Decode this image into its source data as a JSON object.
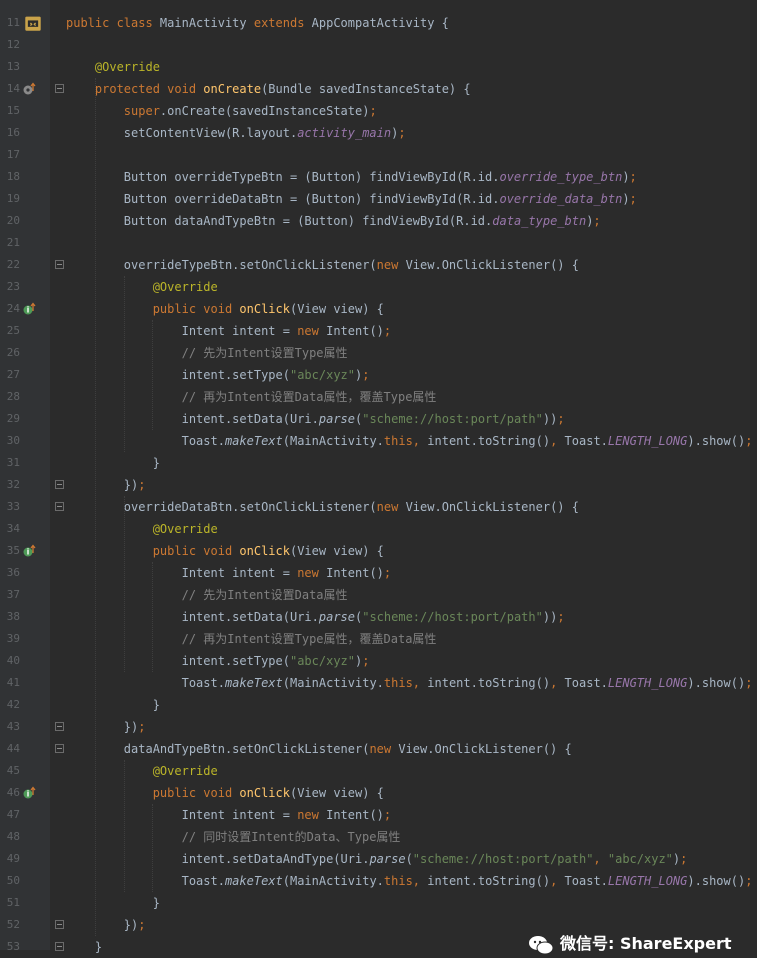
{
  "editor": {
    "lines": [
      {
        "num": "11",
        "segs": [
          [
            "kw",
            "public class "
          ],
          [
            "",
            "MainActivity "
          ],
          [
            "kw",
            "extends "
          ],
          [
            "",
            "AppCompatActivity {"
          ]
        ]
      },
      {
        "num": "12",
        "segs": []
      },
      {
        "num": "13",
        "segs": [
          [
            "",
            "    "
          ],
          [
            "an",
            "@Override"
          ]
        ]
      },
      {
        "num": "14",
        "segs": [
          [
            "",
            "    "
          ],
          [
            "kw",
            "protected void "
          ],
          [
            "fn",
            "onCreate"
          ],
          [
            "",
            "(Bundle savedInstanceState) {"
          ]
        ]
      },
      {
        "num": "15",
        "segs": [
          [
            "",
            "        "
          ],
          [
            "kw",
            "super"
          ],
          [
            "",
            ".onCreate(savedInstanceState)"
          ],
          [
            "kw",
            ";"
          ]
        ]
      },
      {
        "num": "16",
        "segs": [
          [
            "",
            "        setContentView(R.layout."
          ],
          [
            "fi",
            "activity_main"
          ],
          [
            "",
            ")"
          ],
          [
            "kw",
            ";"
          ]
        ]
      },
      {
        "num": "17",
        "segs": []
      },
      {
        "num": "18",
        "segs": [
          [
            "",
            "        Button overrideTypeBtn = (Button) findViewById(R.id."
          ],
          [
            "fi",
            "override_type_btn"
          ],
          [
            "",
            ")"
          ],
          [
            "kw",
            ";"
          ]
        ]
      },
      {
        "num": "19",
        "segs": [
          [
            "",
            "        Button overrideDataBtn = (Button) findViewById(R.id."
          ],
          [
            "fi",
            "override_data_btn"
          ],
          [
            "",
            ")"
          ],
          [
            "kw",
            ";"
          ]
        ]
      },
      {
        "num": "20",
        "segs": [
          [
            "",
            "        Button dataAndTypeBtn = (Button) findViewById(R.id."
          ],
          [
            "fi",
            "data_type_btn"
          ],
          [
            "",
            ")"
          ],
          [
            "kw",
            ";"
          ]
        ]
      },
      {
        "num": "21",
        "segs": []
      },
      {
        "num": "22",
        "segs": [
          [
            "",
            "        overrideTypeBtn.setOnClickListener("
          ],
          [
            "kw",
            "new "
          ],
          [
            "",
            "View.OnClickListener() {"
          ]
        ]
      },
      {
        "num": "23",
        "segs": [
          [
            "",
            "            "
          ],
          [
            "an",
            "@Override"
          ]
        ]
      },
      {
        "num": "24",
        "segs": [
          [
            "",
            "            "
          ],
          [
            "kw",
            "public void "
          ],
          [
            "fn",
            "onClick"
          ],
          [
            "",
            "(View view) {"
          ]
        ]
      },
      {
        "num": "25",
        "segs": [
          [
            "",
            "                Intent intent = "
          ],
          [
            "kw",
            "new "
          ],
          [
            "",
            "Intent()"
          ],
          [
            "kw",
            ";"
          ]
        ]
      },
      {
        "num": "26",
        "segs": [
          [
            "",
            "                "
          ],
          [
            "cm",
            "// 先为Intent设置Type属性"
          ]
        ]
      },
      {
        "num": "27",
        "segs": [
          [
            "",
            "                intent.setType("
          ],
          [
            "st",
            "\"abc/xyz\""
          ],
          [
            "",
            ")"
          ],
          [
            "kw",
            ";"
          ]
        ]
      },
      {
        "num": "28",
        "segs": [
          [
            "",
            "                "
          ],
          [
            "cm",
            "// 再为Intent设置Data属性，覆盖Type属性"
          ]
        ]
      },
      {
        "num": "29",
        "segs": [
          [
            "",
            "                intent.setData(Uri."
          ],
          [
            "sm",
            "parse"
          ],
          [
            "",
            "("
          ],
          [
            "st",
            "\"scheme://host:port/path\""
          ],
          [
            "",
            "))"
          ],
          [
            "kw",
            ";"
          ]
        ]
      },
      {
        "num": "30",
        "segs": [
          [
            "",
            "                Toast."
          ],
          [
            "sm",
            "makeText"
          ],
          [
            "",
            "(MainActivity."
          ],
          [
            "kw",
            "this, "
          ],
          [
            "",
            "intent.toString()"
          ],
          [
            "kw",
            ", "
          ],
          [
            "",
            "Toast."
          ],
          [
            "fi",
            "LENGTH_LONG"
          ],
          [
            "",
            ").show()"
          ],
          [
            "kw",
            ";"
          ]
        ]
      },
      {
        "num": "31",
        "segs": [
          [
            "",
            "            }"
          ]
        ]
      },
      {
        "num": "32",
        "segs": [
          [
            "",
            "        })"
          ],
          [
            "kw",
            ";"
          ]
        ]
      },
      {
        "num": "33",
        "segs": [
          [
            "",
            "        overrideDataBtn.setOnClickListener("
          ],
          [
            "kw",
            "new "
          ],
          [
            "",
            "View.OnClickListener() {"
          ]
        ]
      },
      {
        "num": "34",
        "segs": [
          [
            "",
            "            "
          ],
          [
            "an",
            "@Override"
          ]
        ]
      },
      {
        "num": "35",
        "segs": [
          [
            "",
            "            "
          ],
          [
            "kw",
            "public void "
          ],
          [
            "fn",
            "onClick"
          ],
          [
            "",
            "(View view) {"
          ]
        ]
      },
      {
        "num": "36",
        "segs": [
          [
            "",
            "                Intent intent = "
          ],
          [
            "kw",
            "new "
          ],
          [
            "",
            "Intent()"
          ],
          [
            "kw",
            ";"
          ]
        ]
      },
      {
        "num": "37",
        "segs": [
          [
            "",
            "                "
          ],
          [
            "cm",
            "// 先为Intent设置Data属性"
          ]
        ]
      },
      {
        "num": "38",
        "segs": [
          [
            "",
            "                intent.setData(Uri."
          ],
          [
            "sm",
            "parse"
          ],
          [
            "",
            "("
          ],
          [
            "st",
            "\"scheme://host:port/path\""
          ],
          [
            "",
            "))"
          ],
          [
            "kw",
            ";"
          ]
        ]
      },
      {
        "num": "39",
        "segs": [
          [
            "",
            "                "
          ],
          [
            "cm",
            "// 再为Intent设置Type属性，覆盖Data属性"
          ]
        ]
      },
      {
        "num": "40",
        "segs": [
          [
            "",
            "                intent.setType("
          ],
          [
            "st",
            "\"abc/xyz\""
          ],
          [
            "",
            ")"
          ],
          [
            "kw",
            ";"
          ]
        ]
      },
      {
        "num": "41",
        "segs": [
          [
            "",
            "                Toast."
          ],
          [
            "sm",
            "makeText"
          ],
          [
            "",
            "(MainActivity."
          ],
          [
            "kw",
            "this, "
          ],
          [
            "",
            "intent.toString()"
          ],
          [
            "kw",
            ", "
          ],
          [
            "",
            "Toast."
          ],
          [
            "fi",
            "LENGTH_LONG"
          ],
          [
            "",
            ").show()"
          ],
          [
            "kw",
            ";"
          ]
        ]
      },
      {
        "num": "42",
        "segs": [
          [
            "",
            "            }"
          ]
        ]
      },
      {
        "num": "43",
        "segs": [
          [
            "",
            "        })"
          ],
          [
            "kw",
            ";"
          ]
        ]
      },
      {
        "num": "44",
        "segs": [
          [
            "",
            "        dataAndTypeBtn.setOnClickListener("
          ],
          [
            "kw",
            "new "
          ],
          [
            "",
            "View.OnClickListener() {"
          ]
        ]
      },
      {
        "num": "45",
        "segs": [
          [
            "",
            "            "
          ],
          [
            "an",
            "@Override"
          ]
        ]
      },
      {
        "num": "46",
        "segs": [
          [
            "",
            "            "
          ],
          [
            "kw",
            "public void "
          ],
          [
            "fn",
            "onClick"
          ],
          [
            "",
            "(View view) {"
          ]
        ]
      },
      {
        "num": "47",
        "segs": [
          [
            "",
            "                Intent intent = "
          ],
          [
            "kw",
            "new "
          ],
          [
            "",
            "Intent()"
          ],
          [
            "kw",
            ";"
          ]
        ]
      },
      {
        "num": "48",
        "segs": [
          [
            "",
            "                "
          ],
          [
            "cm",
            "// 同时设置Intent的Data、Type属性"
          ]
        ]
      },
      {
        "num": "49",
        "segs": [
          [
            "",
            "                intent.setDataAndType(Uri."
          ],
          [
            "sm",
            "parse"
          ],
          [
            "",
            "("
          ],
          [
            "st",
            "\"scheme://host:port/path\""
          ],
          [
            "kw",
            ", "
          ],
          [
            "st",
            "\"abc/xyz\""
          ],
          [
            "",
            ")"
          ],
          [
            "kw",
            ";"
          ]
        ]
      },
      {
        "num": "50",
        "segs": [
          [
            "",
            "                Toast."
          ],
          [
            "sm",
            "makeText"
          ],
          [
            "",
            "(MainActivity."
          ],
          [
            "kw",
            "this, "
          ],
          [
            "",
            "intent.toString()"
          ],
          [
            "kw",
            ", "
          ],
          [
            "",
            "Toast."
          ],
          [
            "fi",
            "LENGTH_LONG"
          ],
          [
            "",
            ").show()"
          ],
          [
            "kw",
            ";"
          ]
        ]
      },
      {
        "num": "51",
        "segs": [
          [
            "",
            "            }"
          ]
        ]
      },
      {
        "num": "52",
        "segs": [
          [
            "",
            "        })"
          ],
          [
            "kw",
            ";"
          ]
        ]
      },
      {
        "num": "53",
        "segs": [
          [
            "",
            "    }"
          ]
        ]
      }
    ],
    "gutter_icons": {
      "11": "class-android-icon",
      "14": "override-method-icon",
      "24": "implement-method-icon",
      "35": "implement-method-icon",
      "46": "implement-method-icon"
    },
    "fold_lines": [
      "14",
      "22",
      "32",
      "33",
      "43",
      "44",
      "52",
      "53"
    ]
  },
  "watermark": {
    "text": "微信号: ShareExpert"
  },
  "colors": {
    "background": "#2b2b2b",
    "gutter": "#313335",
    "keyword": "#cc7832",
    "method": "#ffc66d",
    "annotation": "#bbb529",
    "string": "#6a8759",
    "comment": "#808080",
    "field": "#9876aa",
    "text": "#a9b7c6"
  }
}
